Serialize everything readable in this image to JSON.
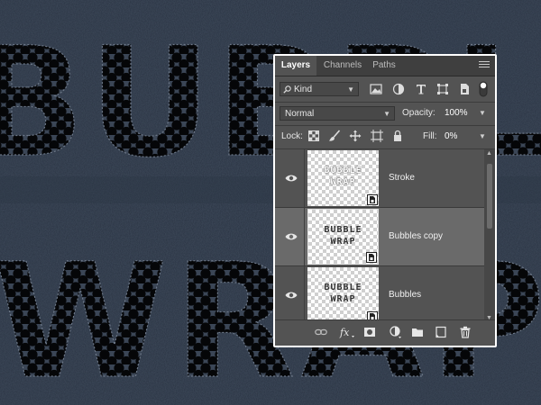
{
  "canvas": {
    "words": [
      "BUBBLE",
      "WRAP"
    ],
    "colors": {
      "leather": "#26303f",
      "bubbles": "#3b4656",
      "holes": "#050608"
    }
  },
  "layers_panel": {
    "tabs": [
      {
        "label": "Layers",
        "active": true
      },
      {
        "label": "Channels",
        "active": false
      },
      {
        "label": "Paths",
        "active": false
      }
    ],
    "menu_icon": "panel-menu-icon",
    "filter": {
      "kind_value": "Kind",
      "kind_icon": "search-icon",
      "filter_icons": [
        "image-filter-icon",
        "adjustment-filter-icon",
        "type-filter-icon",
        "shape-filter-icon",
        "smart-object-filter-icon",
        "filter-toggle-icon"
      ]
    },
    "blend": {
      "mode": "Normal",
      "opacity_label": "Opacity:",
      "opacity_value": "100%"
    },
    "lock": {
      "label": "Lock:",
      "icons": [
        "lock-transparent-icon",
        "lock-image-icon",
        "lock-position-icon",
        "lock-artboard-icon",
        "lock-all-icon"
      ],
      "fill_label": "Fill:",
      "fill_value": "0%"
    },
    "layers": [
      {
        "name": "Stroke",
        "selected": false,
        "thumb_lines": [
          "BUBBLE",
          "WRAP"
        ],
        "thumb_style": "stroke"
      },
      {
        "name": "Bubbles copy",
        "selected": true,
        "thumb_lines": [
          "BUBBLE",
          "WRAP"
        ],
        "thumb_style": "bubbles"
      },
      {
        "name": "Bubbles",
        "selected": false,
        "thumb_lines": [
          "BUBBLE",
          "WRAP"
        ],
        "thumb_style": "bubbles"
      }
    ],
    "footer_icons": [
      "link-layers-icon",
      "fx-icon",
      "add-mask-icon",
      "adjustment-layer-icon",
      "new-group-icon",
      "new-layer-icon",
      "trash-icon"
    ],
    "colors": {
      "panel_bg": "#535353",
      "tab_bar": "#3f3f3f",
      "selected_row": "#6a6a6a",
      "border": "#ffffff"
    }
  }
}
